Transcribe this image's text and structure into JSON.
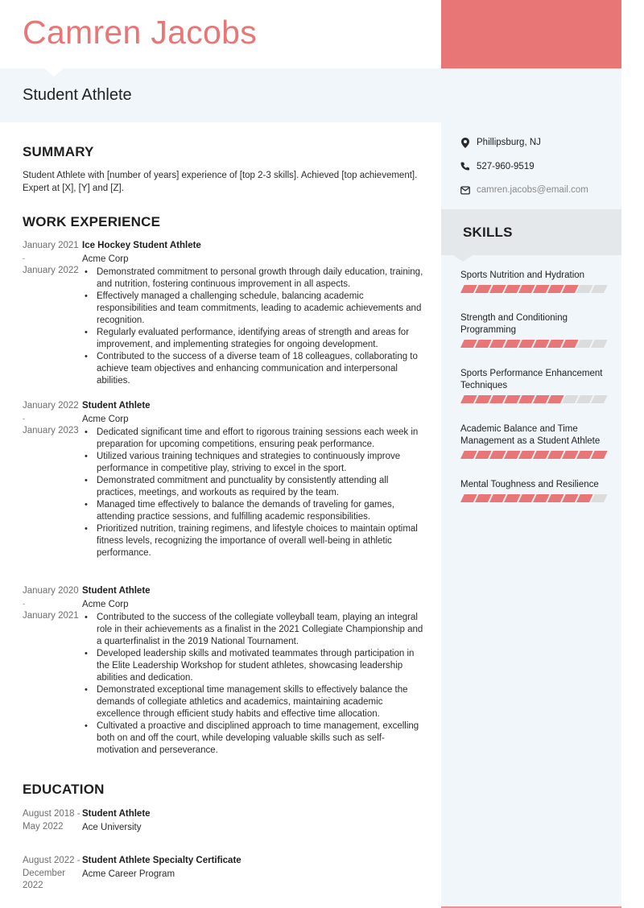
{
  "header": {
    "name": "Camren Jacobs",
    "job_title": "Student Athlete",
    "accent_color": "#e87676"
  },
  "contact": {
    "location": {
      "icon": "map-pin-icon",
      "value": "Phillipsburg, NJ"
    },
    "phone": {
      "icon": "phone-icon",
      "value": "527-960-9519"
    },
    "email": {
      "icon": "envelope-icon",
      "value": "camren.jacobs@email.com"
    }
  },
  "skills": {
    "title": "SKILLS",
    "scale_max": 10,
    "items": [
      {
        "name": "Sports Nutrition and Hydration",
        "level": 8
      },
      {
        "name": "Strength and Conditioning Programming",
        "level": 8
      },
      {
        "name": "Sports Performance Enhancement Techniques",
        "level": 7
      },
      {
        "name": "Academic Balance and Time Management as a Student Athlete",
        "level": 10
      },
      {
        "name": "Mental Toughness and Resilience",
        "level": 9
      }
    ]
  },
  "summary": {
    "title": "SUMMARY",
    "text": "Student Athlete with [number of years] experience of [top 2-3 skills]. Achieved [top achievement]. Expert at [X], [Y] and [Z]."
  },
  "experience": {
    "title": "WORK EXPERIENCE",
    "items": [
      {
        "start": "January 2021",
        "sep": "-",
        "end": "January 2022",
        "role": "Ice Hockey Student Athlete",
        "org": "Acme Corp",
        "bullets": [
          "Demonstrated commitment to personal growth through daily education, training, and nutrition, fostering continuous improvement in all aspects.",
          "Effectively managed a challenging schedule, balancing academic responsibilities and team commitments, leading to academic achievements and recognition.",
          "Regularly evaluated performance, identifying areas of strength and areas for improvement, and implementing strategies for ongoing development.",
          "Contributed to the success of a diverse team of 18 colleagues, collaborating to achieve team objectives and enhancing communication and interpersonal abilities."
        ]
      },
      {
        "start": "January 2022",
        "sep": "-",
        "end": "January 2023",
        "role": "Student Athlete",
        "org": "Acme Corp",
        "bullets": [
          "Dedicated significant time and effort to rigorous training sessions each week in preparation for upcoming competitions, ensuring peak performance.",
          "Utilized various training techniques and strategies to continuously improve performance in competitive play, striving to excel in the sport.",
          "Demonstrated commitment and punctuality by consistently attending all practices, meetings, and workouts as required by the team.",
          "Managed time effectively to balance the demands of traveling for games, attending practice sessions, and fulfilling academic responsibilities.",
          "Prioritized nutrition, training regimens, and lifestyle choices to maintain optimal fitness levels, recognizing the importance of overall well-being in athletic performance."
        ]
      },
      {
        "start": "January 2020",
        "sep": "-",
        "end": "January 2021",
        "role": "Student Athlete",
        "org": "Acme Corp",
        "bullets": [
          "Contributed to the success of the collegiate volleyball team, playing an integral role in their achievements as a finalist in the 2021 Collegiate Championship and a quarterfinalist in the 2019 National Tournament.",
          "Developed leadership skills and motivated teammates through participation in the Elite Leadership Workshop for student athletes, showcasing leadership abilities and dedication.",
          "Demonstrated exceptional time management skills to effectively balance the demands of collegiate athletics and academics, maintaining academic excellence through efficient study habits and effective time allocation.",
          "Cultivated a proactive and disciplined approach to time management, excelling both on and off the court, while developing valuable skills such as self-motivation and perseverance."
        ]
      }
    ]
  },
  "education": {
    "title": "EDUCATION",
    "items": [
      {
        "dates": "August 2018 - May 2022",
        "role": "Student Athlete",
        "org": "Ace University"
      },
      {
        "dates": "August 2022 - December 2022",
        "role": "Student Athlete Specialty Certificate",
        "org": "Acme Career Program"
      }
    ]
  }
}
